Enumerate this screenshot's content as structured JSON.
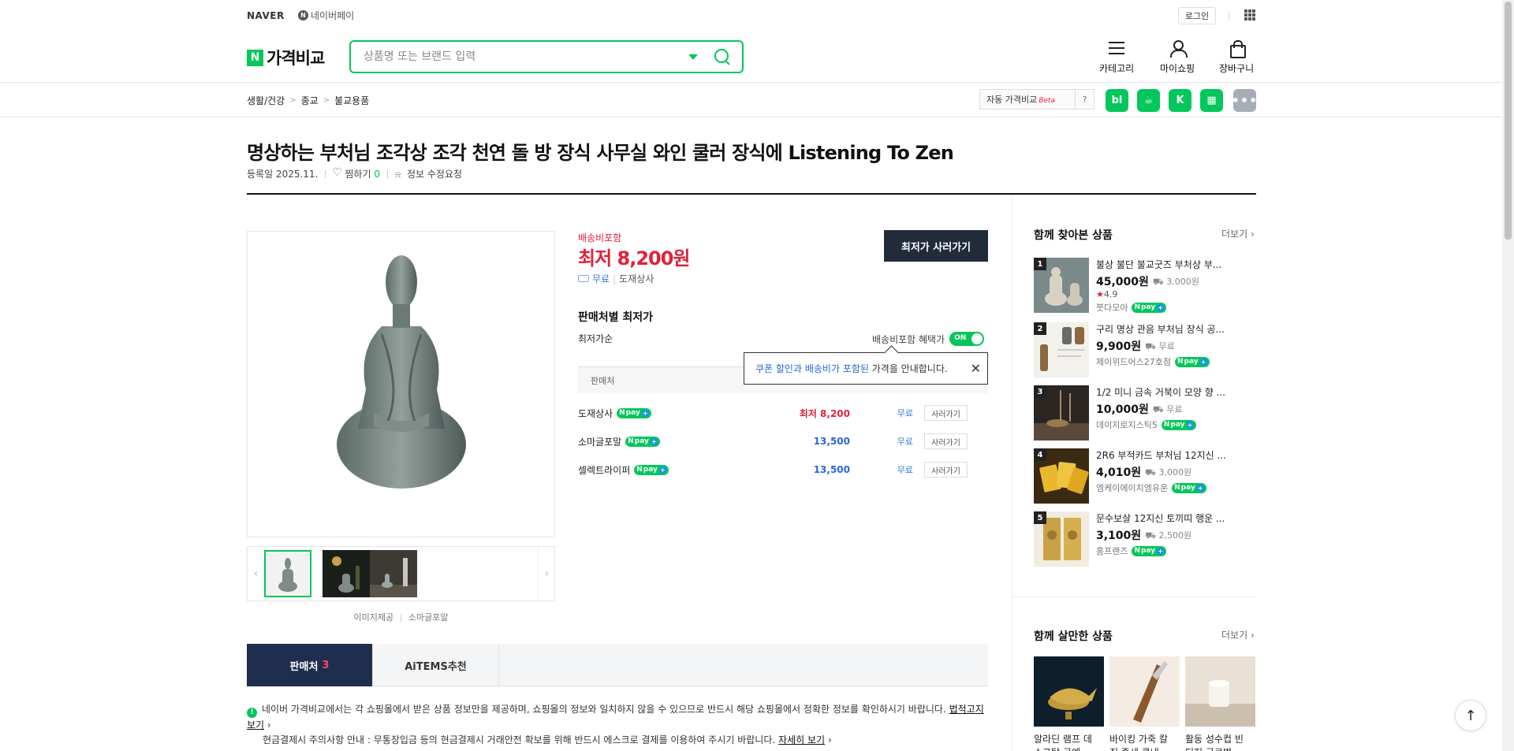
{
  "topbar": {
    "naver": "NAVER",
    "npay_label": "네이버페이",
    "npay_circle": "N",
    "login": "로그인"
  },
  "brand": {
    "n": "N",
    "name": "가격비교"
  },
  "search": {
    "placeholder": "상품명 또는 브랜드 입력"
  },
  "header_tools": [
    {
      "label": "카테고리",
      "icon": "menu-icon"
    },
    {
      "label": "마이쇼핑",
      "icon": "user-icon"
    },
    {
      "label": "장바구니",
      "icon": "cart-icon"
    }
  ],
  "breadcrumb": [
    "생활/건강",
    "종교",
    "불교용품"
  ],
  "breadcrumb_sep": ">",
  "auto_compare": {
    "label": "자동 가격비교",
    "beta": "Beta",
    "help": "?"
  },
  "share_buttons": [
    {
      "label": "bl",
      "icon": "blog-icon"
    },
    {
      "label": "☕",
      "icon": "cafe-icon"
    },
    {
      "label": "K",
      "icon": "keep-icon"
    },
    {
      "label": "▦",
      "icon": "memo-icon"
    },
    {
      "label": "•••",
      "icon": "more-icon"
    }
  ],
  "product": {
    "title": "명상하는 부처님 조각상 조각 천연 돌 방 장식 사무실 와인 쿨러 장식에 Listening To Zen",
    "registered": "등록일 2025.11.",
    "wish_label": "찜하기",
    "wish_count": "0",
    "edit_request": "정보 수정요청",
    "image_credit": "이미지제공",
    "image_source": "소마글포말"
  },
  "price": {
    "ship_included": "배송비포함",
    "lowest": "최저 8,200원",
    "free_ship": "무료",
    "seller": "도재상사",
    "buy_lowest": "최저가 사러가기"
  },
  "seller_section": {
    "title": "판매처별 최저가",
    "sort": "최저가순",
    "ship_benefit": "배송비포함 혜택가",
    "toggle": "ON",
    "head_seller": "판매처",
    "tooltip_blue": "쿠폰 할인과 배송비가 포함된",
    "tooltip_rest": " 가격을 안내합니다.",
    "tooltip_close": "✕",
    "npay": "pay",
    "rows": [
      {
        "name": "도재상사",
        "price": "최저 8,200",
        "ship": "무료",
        "buy": "사러가기",
        "lowest": true
      },
      {
        "name": "소마글포말",
        "price": "13,500",
        "ship": "무료",
        "buy": "사러가기",
        "lowest": false
      },
      {
        "name": "셀렉트라이퍼",
        "price": "13,500",
        "ship": "무료",
        "buy": "사러가기",
        "lowest": false
      }
    ]
  },
  "tabs": [
    {
      "label": "판매처",
      "count": "3",
      "active": true
    },
    {
      "label": "AiTEMS추천",
      "count": "",
      "active": false
    }
  ],
  "notice": {
    "icon": "!",
    "line1": "네이버 가격비교에서는 각 쇼핑몰에서 받은 상품 정보만을 제공하며, 쇼핑몰의 정보와 일치하지 않을 수 있으므로 반드시 해당 쇼핑몰에서 정확한 정보를 확인하시기 바랍니다.",
    "link1": "법적고지 보기",
    "line2": "현금결제시 주의사항 안내 : 무통장입금 등의 현금결제시 거래안전 확보를 위해 반드시 에스크로 결제를 이용하여 주시기 바랍니다.",
    "link2": "자세히 보기"
  },
  "together_viewed": {
    "title": "함께 찾아본 상품",
    "more": "더보기",
    "items": [
      {
        "rank": "1",
        "name": "불상 불단 불교굿즈 부처상 부...",
        "price": "45,000원",
        "ship": "3,000원",
        "rating": "4.9",
        "seller": "붓다모아",
        "npay": true
      },
      {
        "rank": "2",
        "name": "구리 명상 관음 부처님 장식 공...",
        "price": "9,900원",
        "ship": "무료",
        "rating": "",
        "seller": "제이위드어스27호점",
        "npay": true
      },
      {
        "rank": "3",
        "name": "1/2 미니 금속 거북이 모양 향 ...",
        "price": "10,000원",
        "ship": "무료",
        "rating": "",
        "seller": "데이지로지스틱5",
        "npay": true
      },
      {
        "rank": "4",
        "name": "2R6 부적카드 부처님 12지신 ...",
        "price": "4,010원",
        "ship": "3,000원",
        "rating": "",
        "seller": "엠케이에이치엠유운",
        "npay": true
      },
      {
        "rank": "5",
        "name": "문수보살 12지신 토끼띠 행운 ...",
        "price": "3,100원",
        "ship": "2,500원",
        "rating": "",
        "seller": "홈프랜즈",
        "npay": true
      }
    ]
  },
  "buy_together": {
    "title": "함께 살만한 상품",
    "more": "더보기",
    "items": [
      {
        "name": "알라딘 램프 데\n스크탑 공예"
      },
      {
        "name": "바이킹 가죽 칼\n집 중세 클내"
      },
      {
        "name": "활동 성수컵 빈\n티지 글로벌"
      }
    ]
  },
  "to_top": "↑"
}
